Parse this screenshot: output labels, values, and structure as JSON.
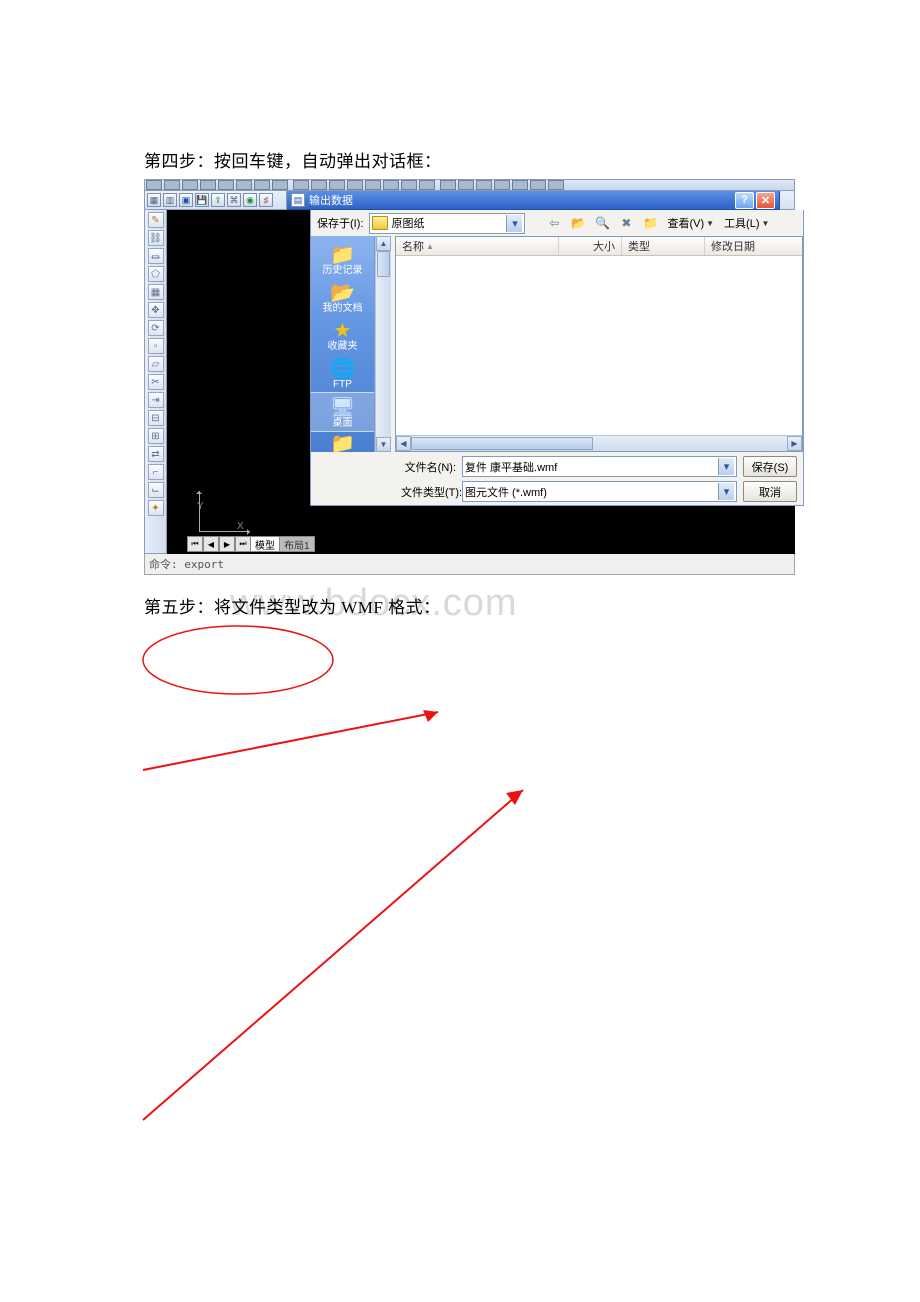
{
  "step4_text": "第四步：按回车键，自动弹出对话框：",
  "step5_text": "第五步：将文件类型改为 WMF 格式：",
  "watermark": "www.bdocx.com",
  "dialog": {
    "title": "输出数据",
    "save_in_label": "保存于(I):",
    "save_in_value": "原图纸",
    "toolbar": {
      "view_label": "查看(V)",
      "tools_label": "工具(L)"
    },
    "columns": {
      "name": "名称",
      "size": "大小",
      "type": "类型",
      "modified": "修改日期"
    },
    "places": {
      "history": "历史记录",
      "mydocs": "我的文档",
      "favorites": "收藏夹",
      "ftp": "FTP",
      "desktop": "桌面"
    },
    "filename_label": "文件名(N):",
    "filename_value": "复件 康平基础.wmf",
    "filetype_label": "文件类型(T):",
    "filetype_value": "图元文件 (*.wmf)",
    "save_btn": "保存(S)",
    "cancel_btn": "取消"
  },
  "tabs": {
    "model": "模型",
    "layout1": "布局1"
  },
  "axis": {
    "x": "X",
    "y": "Y"
  },
  "command": "命令: export"
}
